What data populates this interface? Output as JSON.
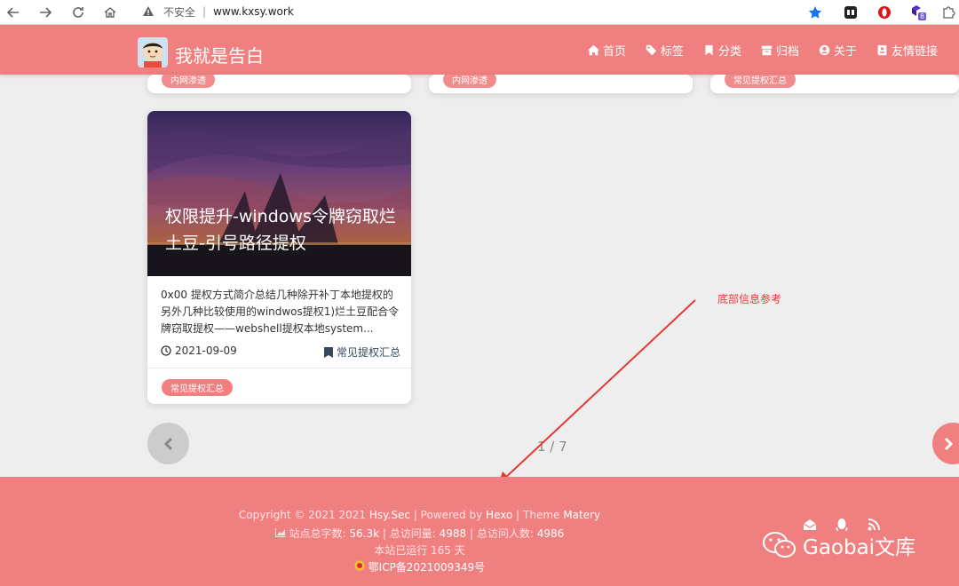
{
  "browser": {
    "security_label": "不安全",
    "url": "www.kxsy.work",
    "extension_badge": "8"
  },
  "site": {
    "title": "我就是告白",
    "menu": [
      {
        "label": "首页",
        "icon": "home-icon"
      },
      {
        "label": "标签",
        "icon": "tags-icon"
      },
      {
        "label": "分类",
        "icon": "bookmark-icon"
      },
      {
        "label": "归档",
        "icon": "archive-icon"
      },
      {
        "label": "关于",
        "icon": "user-circle-icon"
      },
      {
        "label": "友情链接",
        "icon": "address-card-icon"
      }
    ]
  },
  "top_cards": [
    {
      "tag": "内网渗透"
    },
    {
      "tag": "内网渗透"
    },
    {
      "tag": "常见提权汇总"
    }
  ],
  "post": {
    "title": "权限提升-windows令牌窃取烂土豆-引号路径提权",
    "summary": "0x00 提权方式简介总结几种除开补丁本地提权的另外几种比较使用的windwos提权1)烂土豆配合令牌窃取提权——webshell提权本地system...",
    "date": "2021-09-09",
    "category": "常见提权汇总",
    "tag": "常见提权汇总"
  },
  "pagination": {
    "info": "1 / 7"
  },
  "annotation": {
    "text": "底部信息参考"
  },
  "footer": {
    "copyright_prefix": "Copyright © 2021 2021",
    "author": "Hsy.Sec",
    "powered_by": "| Powered by",
    "hexo": "Hexo",
    "theme_label": "| Theme",
    "theme": "Matery",
    "word_count_label": "站点总字数:",
    "word_count": "56.3k",
    "views_label": "|  总访问量:",
    "views": "4988",
    "visitors_label": "|  总访问人数:",
    "visitors": "4986",
    "runtime": "本站已运行 165 天",
    "icp": "鄂ICP备2021009349号",
    "watermark": "Gaobai文库"
  },
  "colors": {
    "brand": "#f08080",
    "annotation": "#e53935"
  }
}
